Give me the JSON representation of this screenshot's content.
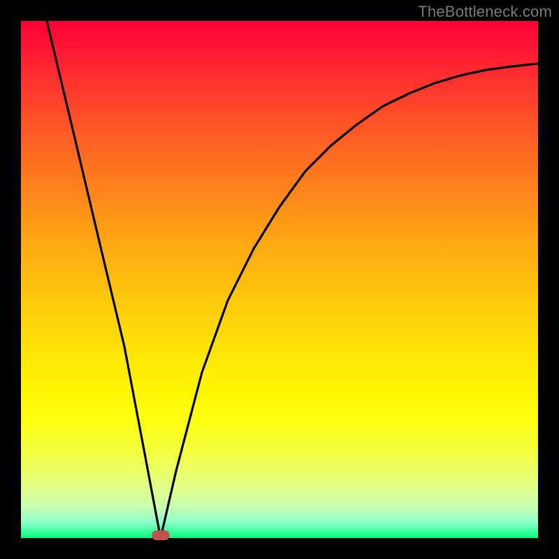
{
  "watermark": "TheBottleneck.com",
  "chart_data": {
    "type": "line",
    "title": "",
    "xlabel": "",
    "ylabel": "",
    "xlim": [
      0,
      100
    ],
    "ylim": [
      0,
      100
    ],
    "grid": false,
    "legend": false,
    "series": [
      {
        "name": "bottleneck-curve",
        "x": [
          5,
          10,
          15,
          20,
          24,
          27,
          30,
          35,
          40,
          45,
          50,
          55,
          60,
          65,
          70,
          75,
          80,
          85,
          90,
          95,
          100
        ],
        "y": [
          100,
          79,
          58,
          37,
          16,
          0,
          13,
          32,
          46,
          56,
          64,
          71,
          76,
          80,
          83.5,
          86,
          88,
          89.5,
          90.5,
          91.2,
          91.8
        ]
      }
    ],
    "marker": {
      "x": 27,
      "y": 0,
      "color": "#c1534e"
    },
    "gradient_stops": [
      {
        "pos": 0,
        "color": "#ff0036"
      },
      {
        "pos": 100,
        "color": "#00ff78"
      }
    ]
  }
}
